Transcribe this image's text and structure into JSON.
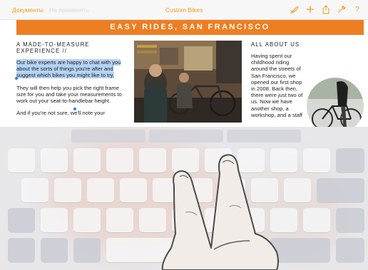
{
  "toolbar": {
    "back_label": "Документы",
    "undo_label": "Не применять",
    "title": "Custom Bikes",
    "icons": [
      "paintbrush-icon",
      "plus-icon",
      "share-icon",
      "wrench-icon",
      "help-icon"
    ],
    "help_label": "?",
    "accent_color": "#f19a1d"
  },
  "document": {
    "banner": "EASY RIDES, SAN FRANCISCO",
    "banner_color": "#ee7e22",
    "left": {
      "heading_line1": "A MADE-TO-MEASURE",
      "heading_line2": "EXPERIENCE //",
      "selected_text": "Our bike experts are happy to chat with you about the sorts of things you're after and suggest which bikes you might like to try.",
      "paragraph2": "They will then help you pick the right frame size for you and take your measurements to work out your seat-to-handlebar height.",
      "paragraph3": "And if you're not sure, we'll note your"
    },
    "right": {
      "heading": "ALL ABOUT US",
      "paragraph": "Having spent our childhood riding around the streets of San Francisco, we opened our first shop in 2008. Back then, there were just two of us. Now we have another shop, a workshop, and a staff"
    },
    "images": [
      "bike-shop-photo",
      "cyclist-circle-photo"
    ]
  },
  "keyboard": {
    "state": "dimmed-trackpad-mode",
    "gesture": "two-finger-touch"
  }
}
